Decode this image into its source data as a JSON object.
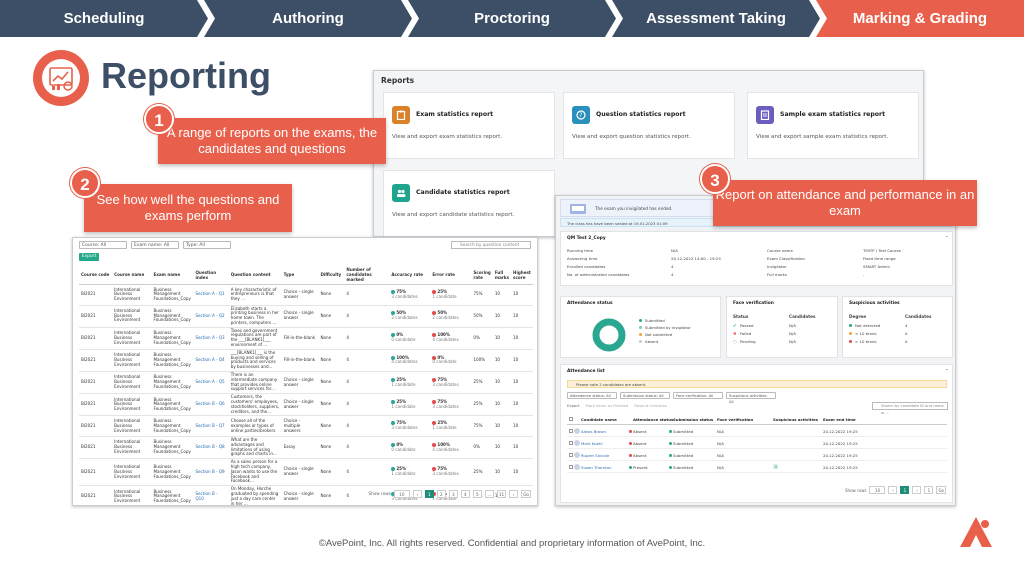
{
  "process_steps": [
    {
      "label": "Scheduling",
      "color": "#3d4f66"
    },
    {
      "label": "Authoring",
      "color": "#3d4f66"
    },
    {
      "label": "Proctoring",
      "color": "#3d4f66"
    },
    {
      "label": "Assessment Taking",
      "color": "#3d4f66"
    },
    {
      "label": "Marking & Grading",
      "color": "#e8604c"
    }
  ],
  "page_title": "Reporting",
  "reports_panel": {
    "title": "Reports",
    "cards": [
      {
        "title": "Exam statistics report",
        "desc": "View and export exam statistics report.",
        "icon": "clipboard-icon",
        "color": "#d9822b"
      },
      {
        "title": "Question statistics report",
        "desc": "View and export question statistics report.",
        "icon": "question-icon",
        "color": "#2b8fbd"
      },
      {
        "title": "Sample exam statistics report",
        "desc": "View and export sample exam statistics report.",
        "icon": "document-icon",
        "color": "#6a5fbf"
      },
      {
        "title": "Candidate statistics report",
        "desc": "View and export candidate statistics report.",
        "icon": "users-icon",
        "color": "#1fa58d"
      }
    ]
  },
  "callouts": [
    {
      "num": "1",
      "text": "A range of reports on the exams, the candidates and questions"
    },
    {
      "num": "2",
      "text": "See how well the questions and exams perform"
    },
    {
      "num": "3",
      "text": "Report on attendance and performance in an exam"
    }
  ],
  "question_table": {
    "filters": [
      "Course: All",
      "Exam name: All",
      "Type: All"
    ],
    "search_placeholder": "Search by question content",
    "export_label": "Export",
    "headers": [
      "Course code",
      "Course name",
      "Exam name",
      "Question index",
      "Question content",
      "Type",
      "Difficulty",
      "Number of candidates marked",
      "Accuracy rate",
      "Error rate",
      "Scoring rate",
      "Full marks",
      "Highest score"
    ],
    "rows": [
      {
        "code": "BI2021",
        "course": "International Business Environment",
        "exam": "Business Management Foundations_Copy",
        "qidx": "Section A - Q1",
        "content": "A key characteristic of entrepreneurs is that they ...",
        "type": "Choice - single answer",
        "diff": "None",
        "marked": "4",
        "acc": "75%",
        "acc_sub": "3 candidates",
        "err": "25%",
        "err_sub": "1 candidate",
        "score": "75%",
        "full": "10",
        "high": "10"
      },
      {
        "code": "BI2021",
        "course": "International Business Environment",
        "exam": "Business Management Foundations_Copy",
        "qidx": "Section A - Q2",
        "content": "Elizabeth starts a printing business in her home town. The printers, computers ...",
        "type": "Choice - single answer",
        "diff": "None",
        "marked": "4",
        "acc": "50%",
        "acc_sub": "2 candidates",
        "err": "50%",
        "err_sub": "2 candidates",
        "score": "50%",
        "full": "10",
        "high": "10"
      },
      {
        "code": "BI2021",
        "course": "International Business Environment",
        "exam": "Business Management Foundations_Copy",
        "qidx": "Section A - Q3",
        "content": "Taxes and government regulations are part of the ___[BLANK1]___ environment of ...",
        "type": "Fill-in-the-blank",
        "diff": "None",
        "marked": "4",
        "acc": "0%",
        "acc_sub": "0 candidate",
        "err": "100%",
        "err_sub": "4 candidates",
        "score": "0%",
        "full": "10",
        "high": "10"
      },
      {
        "code": "BI2021",
        "course": "International Business Environment",
        "exam": "Business Management Foundations_Copy",
        "qidx": "Section A - Q4",
        "content": "___[BLANK1]___ is the buying and selling of products and services by businesses and...",
        "type": "Fill-in-the-blank",
        "diff": "None",
        "marked": "4",
        "acc": "100%",
        "acc_sub": "4 candidates",
        "err": "0%",
        "err_sub": "0 candidate",
        "score": "100%",
        "full": "10",
        "high": "10"
      },
      {
        "code": "BI2021",
        "course": "International Business Environment",
        "exam": "Business Management Foundations_Copy",
        "qidx": "Section A - Q5",
        "content": "There is an intermediate company that provides online support services for...",
        "type": "Choice - single answer",
        "diff": "None",
        "marked": "4",
        "acc": "25%",
        "acc_sub": "1 candidate",
        "err": "75%",
        "err_sub": "3 candidates",
        "score": "25%",
        "full": "10",
        "high": "10"
      },
      {
        "code": "BI2021",
        "course": "International Business Environment",
        "exam": "Business Management Foundations_Copy",
        "qidx": "Section B - Q6",
        "content": "Customers, the customers' employees, stockholders, suppliers, creditors, and the...",
        "type": "Choice - single answer",
        "diff": "None",
        "marked": "4",
        "acc": "25%",
        "acc_sub": "1 candidate",
        "err": "75%",
        "err_sub": "3 candidates",
        "score": "25%",
        "full": "10",
        "high": "10"
      },
      {
        "code": "BI2021",
        "course": "International Business Environment",
        "exam": "Business Management Foundations_Copy",
        "qidx": "Section B - Q7",
        "content": "Choose all of the examples or types of online parties/brokers",
        "type": "Choice - multiple answers",
        "diff": "None",
        "marked": "4",
        "acc": "75%",
        "acc_sub": "3 candidates",
        "err": "25%",
        "err_sub": "1 candidate",
        "score": "75%",
        "full": "10",
        "high": "10"
      },
      {
        "code": "BI2021",
        "course": "International Business Environment",
        "exam": "Business Management Foundations_Copy",
        "qidx": "Section B - Q8",
        "content": "What are the advantages and limitations of using graphs and charts in...",
        "type": "Essay",
        "diff": "None",
        "marked": "4",
        "acc": "0%",
        "acc_sub": "0 candidate",
        "err": "100%",
        "err_sub": "4 candidates",
        "score": "0%",
        "full": "10",
        "high": "10"
      },
      {
        "code": "BI2021",
        "course": "International Business Environment",
        "exam": "Business Management Foundations_Copy",
        "qidx": "Section B - Q9",
        "content": "As a sales person for a high tech company, Jason wants to use the Facebook and Facebook...",
        "type": "Choice - single answer",
        "diff": "None",
        "marked": "4",
        "acc": "25%",
        "acc_sub": "1 candidate",
        "err": "75%",
        "err_sub": "3 candidates",
        "score": "25%",
        "full": "10",
        "high": "10"
      },
      {
        "code": "BI2021",
        "course": "International Business Environment",
        "exam": "Business Management Foundations_Copy",
        "qidx": "Section B - Q10",
        "content": "On Monday, Horche graduated by spending just a day care center in her ...",
        "type": "Choice - single answer",
        "diff": "None",
        "marked": "4",
        "acc": "75%",
        "acc_sub": "3 candidates",
        "err": "25%",
        "err_sub": "1 candidate",
        "score": "75%",
        "full": "10",
        "high": "10"
      }
    ],
    "pager": {
      "show_rows": "Show rows",
      "rows_value": "10",
      "pages": [
        "1",
        "2",
        "3",
        "4",
        "5",
        "...",
        "11"
      ],
      "active": "1",
      "go": "Go"
    }
  },
  "attendance": {
    "notice": "The exam you invigilated has ended.",
    "sub_notice": "The class has have been sealed at 19.01.2023 01:09",
    "exam_name": "QM Test 2_Copy",
    "info_left": [
      {
        "k": "Running time",
        "v": "N/A"
      },
      {
        "k": "Answering time",
        "v": "20.12.2022 14:00 - 19:25"
      },
      {
        "k": "Enrolled candidates",
        "v": "4"
      },
      {
        "k": "No. of administrated candidates",
        "v": "4"
      }
    ],
    "info_right": [
      {
        "k": "Course name",
        "v": "TMITP / Test Course"
      },
      {
        "k": "Exam Classification",
        "v": "Fixed time range"
      },
      {
        "k": "Invigilator",
        "v": "SMART Admin"
      },
      {
        "k": "Full marks",
        "v": "-"
      }
    ],
    "status_title": "Attendance status",
    "status_legend": [
      "Submitted",
      "Submitted by invigilator",
      "Not submitted",
      "Absent"
    ],
    "face_title": "Face verification",
    "face_headers": [
      "Status",
      "Candidates"
    ],
    "face_rows": [
      {
        "k": "Passed",
        "v": "N/A"
      },
      {
        "k": "Failed",
        "v": "N/A"
      },
      {
        "k": "Pending",
        "v": "N/A"
      }
    ],
    "susp_title": "Suspicious activities",
    "susp_headers": [
      "Degree",
      "Candidates"
    ],
    "susp_rows": [
      {
        "k": "Not detected",
        "v": "4"
      },
      {
        "k": "< 10 times",
        "v": "0"
      },
      {
        "k": "> 10 times",
        "v": "0"
      }
    ],
    "list_title": "Attendance list",
    "list_warning": "Please note 2 candidates are absent.",
    "list_filters": [
      "Attendance status: All",
      "Submission status: All",
      "Face verification: All",
      "Suspicious activities: All"
    ],
    "list_actions": [
      "Export",
      "Mark exam as finished",
      "Resend invitation"
    ],
    "list_search": "Search by candidate ID and name or ...",
    "list_headers": [
      "Candidate name",
      "Attendance status",
      "Submission status",
      "Face verification",
      "Suspicious activities",
      "Exam end time"
    ],
    "list_rows": [
      {
        "name": "Alexis Brown",
        "att": "Absent",
        "sub": "Submitted",
        "face": "N/A",
        "susp": "",
        "end": "20.12.2022 19:25"
      },
      {
        "name": "Mark Kuehl",
        "att": "Absent",
        "sub": "Submitted",
        "face": "N/A",
        "susp": "",
        "end": "20.12.2022 19:25"
      },
      {
        "name": "Rupert Sinclair",
        "att": "Absent",
        "sub": "Submitted",
        "face": "N/A",
        "susp": "",
        "end": "20.12.2022 19:25"
      },
      {
        "name": "Susan Thornton",
        "att": "Present",
        "sub": "Submitted",
        "face": "N/A",
        "susp": "0",
        "end": "20.12.2022 19:25"
      }
    ],
    "pager": {
      "show_rows": "Show rows",
      "rows_value": "10",
      "active": "1",
      "last": "1",
      "go": "Go"
    }
  },
  "footer": "©AvePoint, Inc. All rights reserved. Confidential and proprietary information of AvePoint, Inc."
}
